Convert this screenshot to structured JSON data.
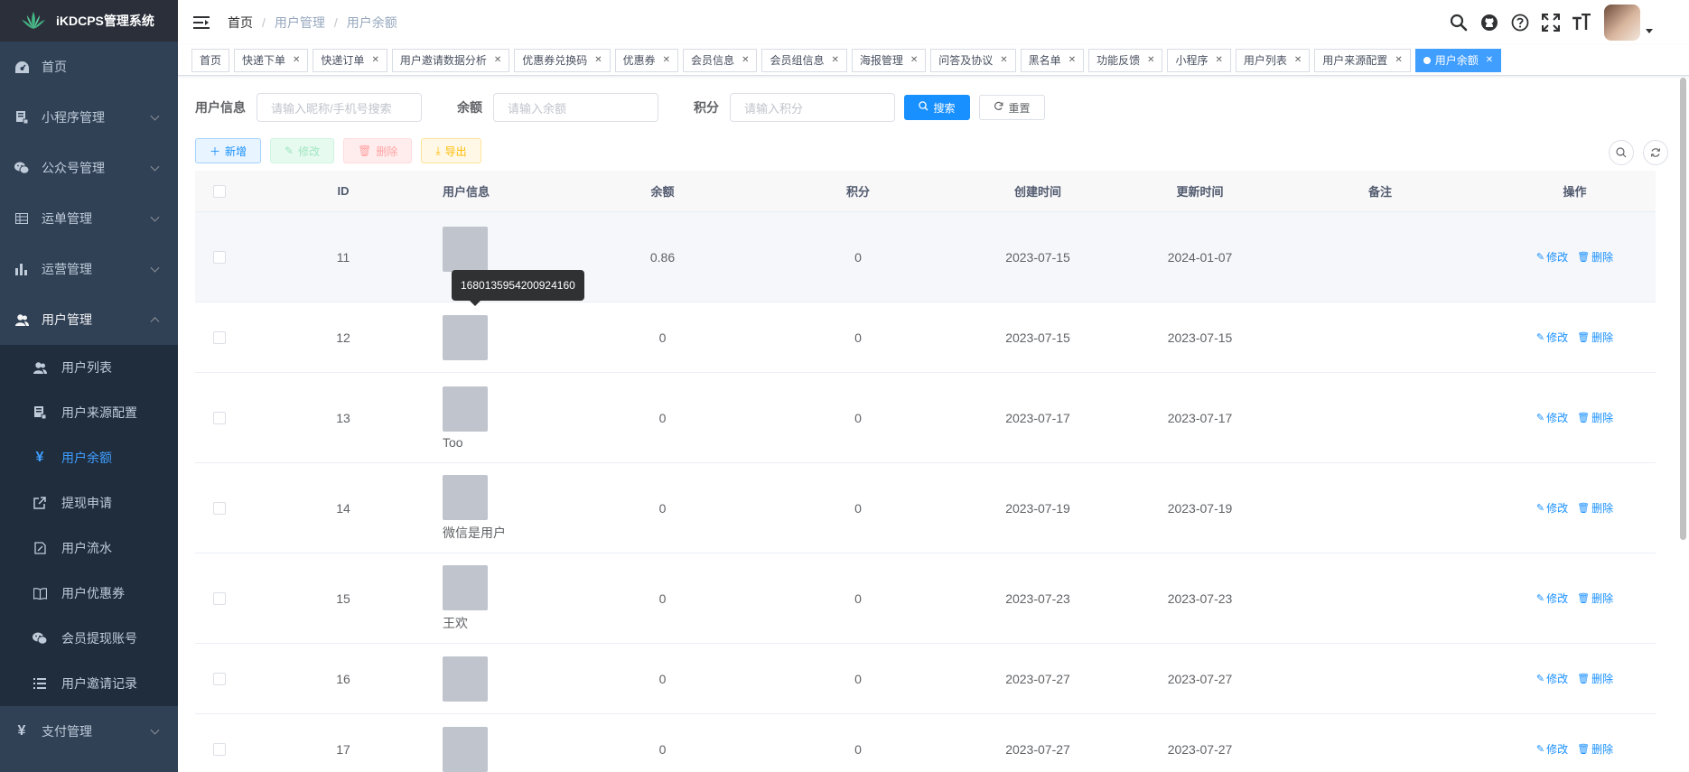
{
  "app": {
    "title": "iKDCPS管理系统"
  },
  "sidebar": {
    "items": [
      {
        "label": "首页",
        "icon": "dashboard-icon"
      },
      {
        "label": "小程序管理",
        "icon": "server-icon"
      },
      {
        "label": "公众号管理",
        "icon": "wechat-icon"
      },
      {
        "label": "运单管理",
        "icon": "table-icon"
      },
      {
        "label": "运营管理",
        "icon": "chart-icon"
      },
      {
        "label": "用户管理",
        "icon": "peoples-icon"
      },
      {
        "label": "支付管理",
        "icon": "yen-icon"
      }
    ],
    "subitems": [
      {
        "label": "用户列表",
        "icon": "peoples-icon"
      },
      {
        "label": "用户来源配置",
        "icon": "server-icon"
      },
      {
        "label": "用户余额",
        "icon": "yen-icon",
        "active": true
      },
      {
        "label": "提现申请",
        "icon": "external-link-icon"
      },
      {
        "label": "用户流水",
        "icon": "edit-doc-icon"
      },
      {
        "label": "用户优惠券",
        "icon": "book-icon"
      },
      {
        "label": "会员提现账号",
        "icon": "wechat-icon"
      },
      {
        "label": "用户邀请记录",
        "icon": "list-icon"
      }
    ]
  },
  "breadcrumb": [
    "首页",
    "用户管理",
    "用户余额"
  ],
  "tags": [
    "首页",
    "快递下单",
    "快递订单",
    "用户邀请数据分析",
    "优惠券兑换码",
    "优惠券",
    "会员信息",
    "会员组信息",
    "海报管理",
    "问答及协议",
    "黑名单",
    "功能反馈",
    "小程序",
    "用户列表",
    "用户来源配置",
    "用户余额"
  ],
  "search": {
    "user_label": "用户信息",
    "user_placeholder": "请输入昵称/手机号搜索",
    "balance_label": "余额",
    "balance_placeholder": "请输入余额",
    "points_label": "积分",
    "points_placeholder": "请输入积分",
    "search_btn": "搜索",
    "reset_btn": "重置"
  },
  "toolbar": {
    "add": "新增",
    "edit": "修改",
    "delete": "删除",
    "export": "导出"
  },
  "table": {
    "headers": {
      "id": "ID",
      "user": "用户信息",
      "balance": "余额",
      "points": "积分",
      "created": "创建时间",
      "updated": "更新时间",
      "note": "备注",
      "ops": "操作"
    },
    "edit_label": "修改",
    "delete_label": "删除",
    "rows": [
      {
        "id": "11",
        "name": "",
        "balance": "0.86",
        "points": "0",
        "created": "2023-07-15",
        "updated": "2024-01-07"
      },
      {
        "id": "12",
        "name": "",
        "balance": "0",
        "points": "0",
        "created": "2023-07-15",
        "updated": "2023-07-15"
      },
      {
        "id": "13",
        "name": "Too",
        "balance": "0",
        "points": "0",
        "created": "2023-07-17",
        "updated": "2023-07-17"
      },
      {
        "id": "14",
        "name": "微信是用户",
        "balance": "0",
        "points": "0",
        "created": "2023-07-19",
        "updated": "2023-07-19"
      },
      {
        "id": "15",
        "name": "王欢",
        "balance": "0",
        "points": "0",
        "created": "2023-07-23",
        "updated": "2023-07-23"
      },
      {
        "id": "16",
        "name": "",
        "balance": "0",
        "points": "0",
        "created": "2023-07-27",
        "updated": "2023-07-27"
      },
      {
        "id": "17",
        "name": "",
        "balance": "0",
        "points": "0",
        "created": "2023-07-27",
        "updated": "2023-07-27"
      }
    ]
  },
  "tooltip": {
    "text": "1680135954200924160"
  },
  "colors": {
    "sidebar_bg": "#304156",
    "submenu_bg": "#1f2d3d",
    "primary": "#1890ff",
    "active_tag": "#409eff"
  }
}
